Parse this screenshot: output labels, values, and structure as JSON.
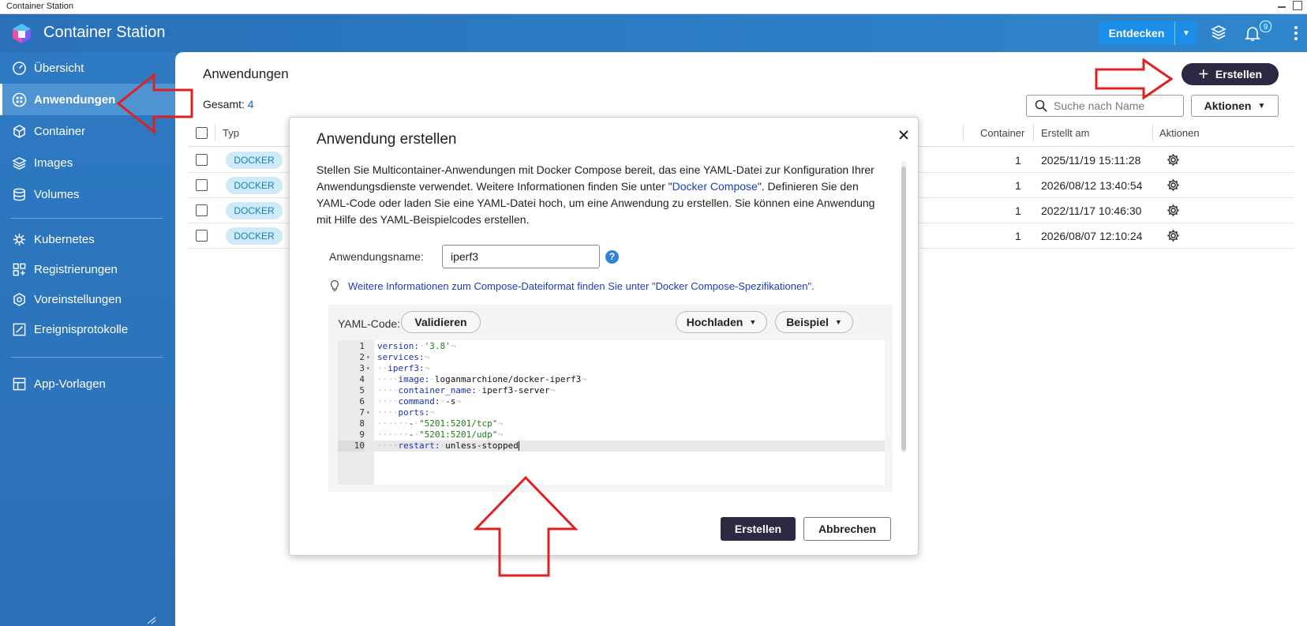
{
  "window": {
    "title": "Container Station"
  },
  "header": {
    "app_title": "Container Station",
    "discover_label": "Entdecken",
    "notification_count": "9",
    "icons": [
      "stack-icon",
      "bell-icon",
      "more-vertical-icon"
    ]
  },
  "sidebar": {
    "items": [
      {
        "label": "Übersicht",
        "icon": "dashboard-icon"
      },
      {
        "label": "Anwendungen",
        "icon": "apps-icon",
        "active": true
      },
      {
        "label": "Container",
        "icon": "cube-icon"
      },
      {
        "label": "Images",
        "icon": "layers-icon"
      },
      {
        "label": "Volumes",
        "icon": "database-icon"
      },
      {
        "label": "Kubernetes",
        "icon": "helm-icon"
      },
      {
        "label": "Registrierungen",
        "icon": "registry-icon"
      },
      {
        "label": "Voreinstellungen",
        "icon": "settings-icon"
      },
      {
        "label": "Ereignisprotokolle",
        "icon": "log-icon"
      },
      {
        "label": "App-Vorlagen",
        "icon": "template-icon"
      }
    ]
  },
  "main": {
    "title": "Anwendungen",
    "total_label": "Gesamt:",
    "total_value": "4",
    "create_label": "Erstellen",
    "search_placeholder": "Suche nach Name",
    "actions_label": "Aktionen",
    "columns": {
      "type": "Typ",
      "container": "Container",
      "created": "Erstellt am",
      "actions": "Aktionen"
    },
    "rows": [
      {
        "type": "DOCKER",
        "container": "1",
        "created": "2025/11/19 15:11:28"
      },
      {
        "type": "DOCKER",
        "container": "1",
        "created": "2026/08/12 13:40:54"
      },
      {
        "type": "DOCKER",
        "container": "1",
        "created": "2022/11/17 10:46:30"
      },
      {
        "type": "DOCKER",
        "container": "1",
        "created": "2026/08/07 12:10:24"
      }
    ]
  },
  "modal": {
    "title": "Anwendung erstellen",
    "description_part1": "Stellen Sie Multicontainer-Anwendungen mit Docker Compose bereit, das eine YAML-Datei zur Konfiguration Ihrer Anwendungsdienste verwendet. Weitere Informationen finden Sie unter \"",
    "description_link": "Docker Compose",
    "description_part2": "\". Definieren Sie den YAML-Code oder laden Sie eine YAML-Datei hoch, um eine Anwendung zu erstellen. Sie können eine Anwendung mit Hilfe des YAML-Beispielcodes erstellen.",
    "name_label": "Anwendungsname:",
    "name_value": "iperf3",
    "hint_part1": "Weitere Informationen zum Compose-Dateiformat finden Sie unter \"",
    "hint_link": "Docker Compose-Spezifikationen",
    "hint_part2": "\".",
    "yaml_label": "YAML-Code:",
    "validate_label": "Validieren",
    "upload_label": "Hochladen",
    "example_label": "Beispiel",
    "yaml_lines": [
      "version: '3.8'",
      "services:",
      "  iperf3:",
      "    image: loganmarchione/docker-iperf3",
      "    container_name: iperf3-server",
      "    command: -s",
      "    ports:",
      "      - \"5201:5201/tcp\"",
      "      - \"5201:5201/udp\"",
      "    restart: unless-stopped"
    ],
    "submit_label": "Erstellen",
    "cancel_label": "Abbrechen"
  },
  "colors": {
    "accent": "#2c2a43",
    "header": "#2b78bf",
    "sidebar_active": "#4e94d3",
    "tag_bg": "#cdeaf6",
    "annotation_arrow": "#e02020"
  }
}
